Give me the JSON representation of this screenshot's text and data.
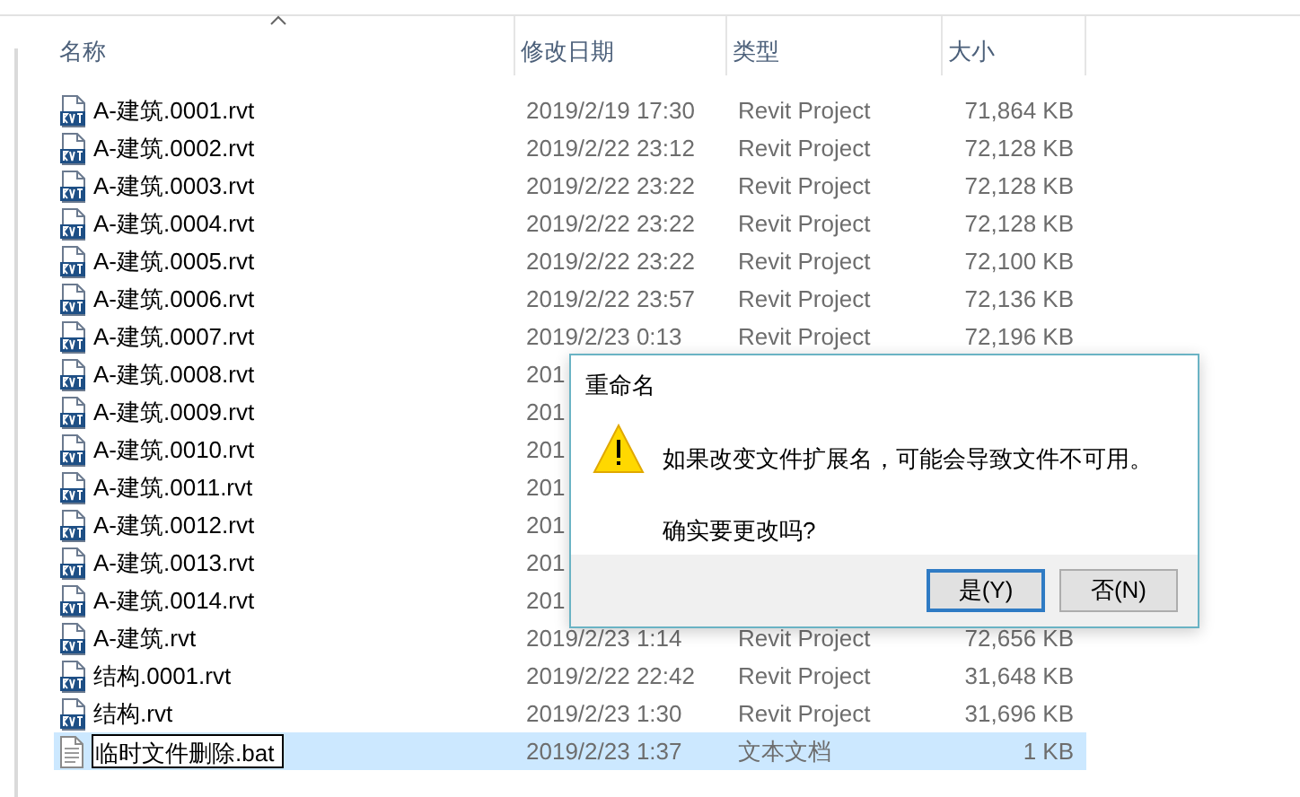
{
  "columns": [
    {
      "label": "名称",
      "sorted": true
    },
    {
      "label": "修改日期",
      "sorted": false
    },
    {
      "label": "类型",
      "sorted": false
    },
    {
      "label": "大小",
      "sorted": false
    }
  ],
  "rows": [
    {
      "kind": "rvt",
      "name": "A-建筑.0001.rvt",
      "date": "2019/2/19 17:30",
      "type": "Revit Project",
      "size": "71,864 KB",
      "selected": false
    },
    {
      "kind": "rvt",
      "name": "A-建筑.0002.rvt",
      "date": "2019/2/22 23:12",
      "type": "Revit Project",
      "size": "72,128 KB",
      "selected": false
    },
    {
      "kind": "rvt",
      "name": "A-建筑.0003.rvt",
      "date": "2019/2/22 23:22",
      "type": "Revit Project",
      "size": "72,128 KB",
      "selected": false
    },
    {
      "kind": "rvt",
      "name": "A-建筑.0004.rvt",
      "date": "2019/2/22 23:22",
      "type": "Revit Project",
      "size": "72,128 KB",
      "selected": false
    },
    {
      "kind": "rvt",
      "name": "A-建筑.0005.rvt",
      "date": "2019/2/22 23:22",
      "type": "Revit Project",
      "size": "72,100 KB",
      "selected": false
    },
    {
      "kind": "rvt",
      "name": "A-建筑.0006.rvt",
      "date": "2019/2/22 23:57",
      "type": "Revit Project",
      "size": "72,136 KB",
      "selected": false
    },
    {
      "kind": "rvt",
      "name": "A-建筑.0007.rvt",
      "date": "2019/2/23 0:13",
      "type": "Revit Project",
      "size": "72,196 KB",
      "selected": false
    },
    {
      "kind": "rvt",
      "name": "A-建筑.0008.rvt",
      "date": "201",
      "selected": false
    },
    {
      "kind": "rvt",
      "name": "A-建筑.0009.rvt",
      "date": "201",
      "selected": false
    },
    {
      "kind": "rvt",
      "name": "A-建筑.0010.rvt",
      "date": "201",
      "selected": false
    },
    {
      "kind": "rvt",
      "name": "A-建筑.0011.rvt",
      "date": "201",
      "selected": false
    },
    {
      "kind": "rvt",
      "name": "A-建筑.0012.rvt",
      "date": "201",
      "selected": false
    },
    {
      "kind": "rvt",
      "name": "A-建筑.0013.rvt",
      "date": "201",
      "selected": false
    },
    {
      "kind": "rvt",
      "name": "A-建筑.0014.rvt",
      "date": "201",
      "selected": false
    },
    {
      "kind": "rvt",
      "name": "A-建筑.rvt",
      "date": "2019/2/23 1:14",
      "type": "Revit Project",
      "size": "72,656 KB",
      "selected": false
    },
    {
      "kind": "rvt",
      "name": "结构.0001.rvt",
      "date": "2019/2/22 22:42",
      "type": "Revit Project",
      "size": "31,648 KB",
      "selected": false
    },
    {
      "kind": "rvt",
      "name": "结构.rvt",
      "date": "2019/2/23 1:30",
      "type": "Revit Project",
      "size": "31,696 KB",
      "selected": false
    },
    {
      "kind": "text",
      "name": "临时文件删除.bat",
      "date": "2019/2/23 1:37",
      "type": "文本文档",
      "size": "1 KB",
      "selected": true,
      "editing": true
    }
  ],
  "dialog": {
    "title": "重命名",
    "message": "如果改变文件扩展名，可能会导致文件不可用。",
    "question": "确实要更改吗?",
    "buttons": [
      {
        "label": "是(Y)",
        "default": true
      },
      {
        "label": "否(N)",
        "default": false
      }
    ]
  }
}
